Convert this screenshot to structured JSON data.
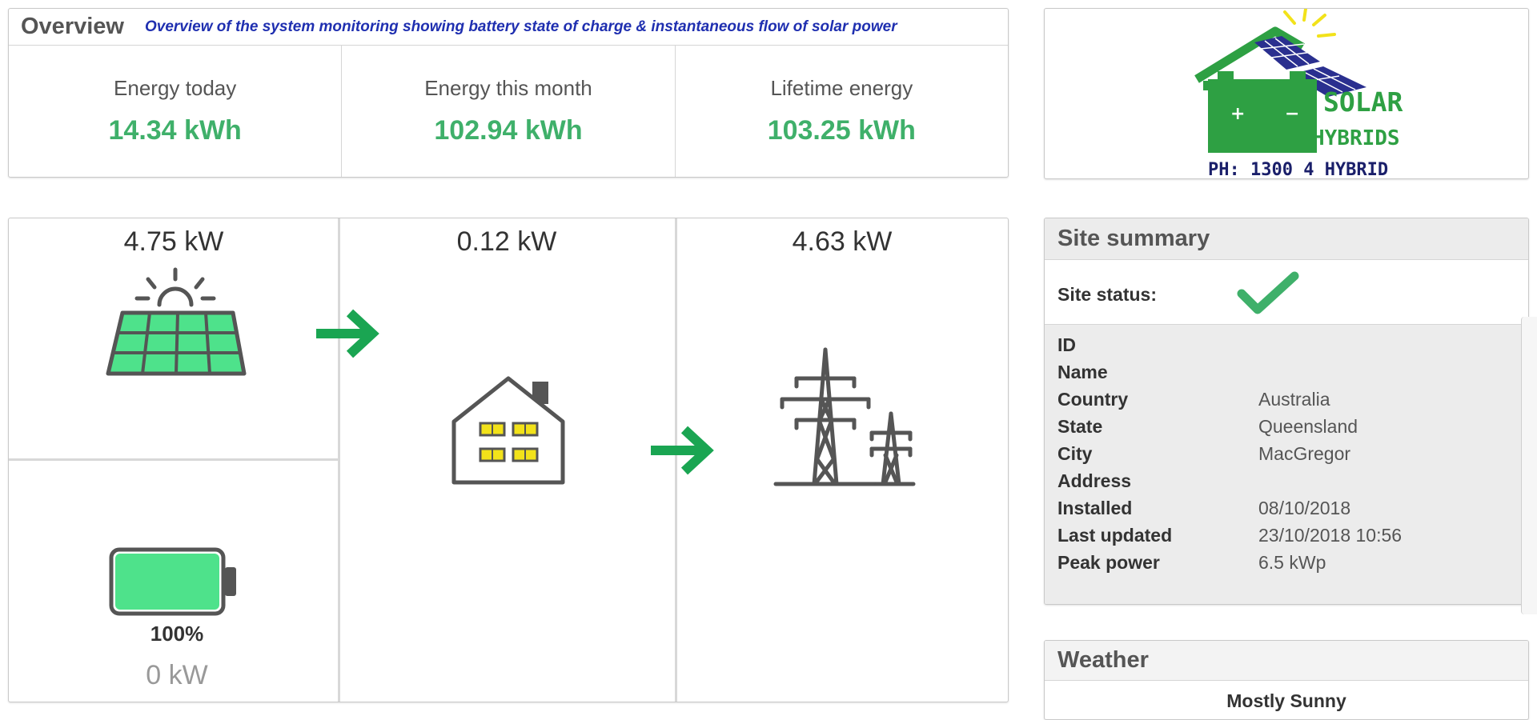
{
  "overview": {
    "title": "Overview",
    "description": "Overview of the system monitoring showing battery state of charge & instantaneous flow of solar power",
    "stats": [
      {
        "label": "Energy today",
        "value": "14.34 kWh"
      },
      {
        "label": "Energy this month",
        "value": "102.94 kWh"
      },
      {
        "label": "Lifetime energy",
        "value": "103.25 kWh"
      }
    ]
  },
  "logo": {
    "line1": "SOLAR",
    "line2": "HYBRIDS",
    "phone": "PH: 1300 4 HYBRID",
    "plus": "+",
    "minus": "−"
  },
  "flow": {
    "solar_kw": "4.75 kW",
    "home_kw": "0.12 kW",
    "grid_kw": "4.63 kW",
    "battery_percent": "100%",
    "battery_level": 1.0,
    "battery_kw": "0 kW",
    "icons": [
      "sun-icon",
      "solar-panel-icon",
      "arrow-right-icon",
      "house-icon",
      "power-tower-icon",
      "battery-icon"
    ]
  },
  "site_summary": {
    "title": "Site summary",
    "status_label": "Site status:",
    "status_icon": "checkmark-icon",
    "rows": [
      {
        "key": "ID",
        "value": ""
      },
      {
        "key": "Name",
        "value": ""
      },
      {
        "key": "Country",
        "value": "Australia"
      },
      {
        "key": "State",
        "value": "Queensland"
      },
      {
        "key": "City",
        "value": "MacGregor"
      },
      {
        "key": "Address",
        "value": ""
      },
      {
        "key": "Installed",
        "value": "08/10/2018"
      },
      {
        "key": "Last updated",
        "value": "23/10/2018 10:56"
      },
      {
        "key": "Peak power",
        "value": "6.5 kWp"
      }
    ]
  },
  "weather": {
    "title": "Weather",
    "condition": "Mostly Sunny"
  },
  "colors": {
    "value_green": "#3fb06a",
    "arrow_green": "#1aa552",
    "panel_fill": "#4ee28b",
    "icon_gray": "#555555",
    "description_blue": "#1f2fb0"
  }
}
